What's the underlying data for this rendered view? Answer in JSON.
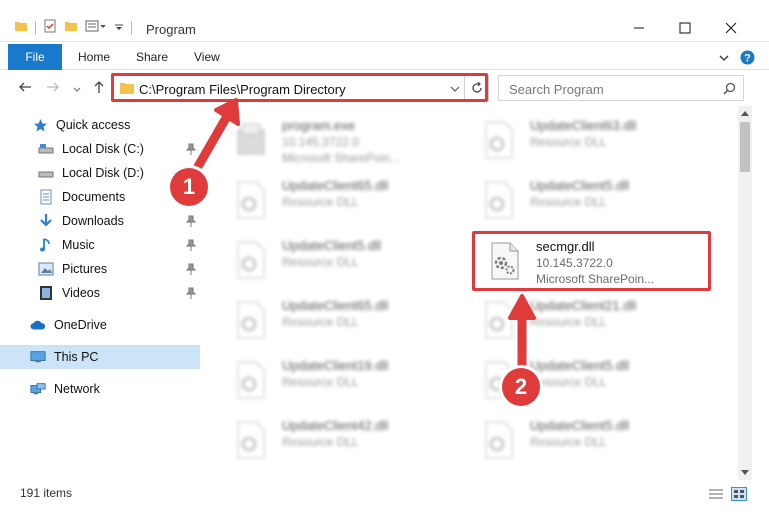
{
  "window": {
    "title": "Program"
  },
  "ribbon": {
    "tabs": [
      "File",
      "Home",
      "Share",
      "View"
    ]
  },
  "address": {
    "path": "C:\\Program Files\\Program Directory"
  },
  "search": {
    "placeholder": "Search Program"
  },
  "sidebar": {
    "items": [
      {
        "label": "Quick access",
        "icon": "star-icon"
      },
      {
        "label": "Local Disk (C:)",
        "icon": "drive-icon",
        "pinned": true
      },
      {
        "label": "Local Disk (D:)",
        "icon": "drive-icon"
      },
      {
        "label": "Documents",
        "icon": "documents-icon"
      },
      {
        "label": "Downloads",
        "icon": "downloads-icon",
        "pinned": true
      },
      {
        "label": "Music",
        "icon": "music-icon",
        "pinned": true
      },
      {
        "label": "Pictures",
        "icon": "pictures-icon",
        "pinned": true
      },
      {
        "label": "Videos",
        "icon": "videos-icon",
        "pinned": true
      },
      {
        "label": "OneDrive",
        "icon": "cloud-icon"
      },
      {
        "label": "This PC",
        "icon": "computer-icon",
        "selected": true
      },
      {
        "label": "Network",
        "icon": "network-icon"
      }
    ]
  },
  "files": [
    {
      "name": "program.exe",
      "sub1": "10.145.3722.0",
      "sub2": "Microsoft SharePoin...",
      "blurred": true,
      "type": "exe"
    },
    {
      "name": "UpdateClient63.dll",
      "sub1": "Resource DLL",
      "blurred": true,
      "type": "dll"
    },
    {
      "name": "UpdateClient65.dll",
      "sub1": "Resource DLL",
      "blurred": true,
      "type": "dll"
    },
    {
      "name": "UpdateClient5.dll",
      "sub1": "Resource DLL",
      "blurred": true,
      "type": "dll"
    },
    {
      "name": "UpdateClient5.dll",
      "sub1": "Resource DLL",
      "blurred": true,
      "type": "dll"
    },
    {
      "name": "secmgr.dll",
      "sub1": "10.145.3722.0",
      "sub2": "Microsoft SharePoin...",
      "blurred": false,
      "type": "dll"
    },
    {
      "name": "UpdateClient65.dll",
      "sub1": "Resource DLL",
      "blurred": true,
      "type": "dll"
    },
    {
      "name": "UpdateClient21.dll",
      "sub1": "Resource DLL",
      "blurred": true,
      "type": "dll"
    },
    {
      "name": "UpdateClient19.dll",
      "sub1": "Resource DLL",
      "blurred": true,
      "type": "dll"
    },
    {
      "name": "UpdateClient5.dll",
      "sub1": "Resource DLL",
      "blurred": true,
      "type": "dll"
    },
    {
      "name": "UpdateClient42.dll",
      "sub1": "Resource DLL",
      "blurred": true,
      "type": "dll"
    },
    {
      "name": "UpdateClient5.dll",
      "sub1": "Resource DLL",
      "blurred": true,
      "type": "dll"
    }
  ],
  "status": {
    "item_count": "191 items"
  },
  "annotations": {
    "badge1": "1",
    "badge2": "2",
    "highlight_color": "#e03b3b"
  },
  "colors": {
    "accent": "#1979ca",
    "selection": "#cce4f7"
  }
}
